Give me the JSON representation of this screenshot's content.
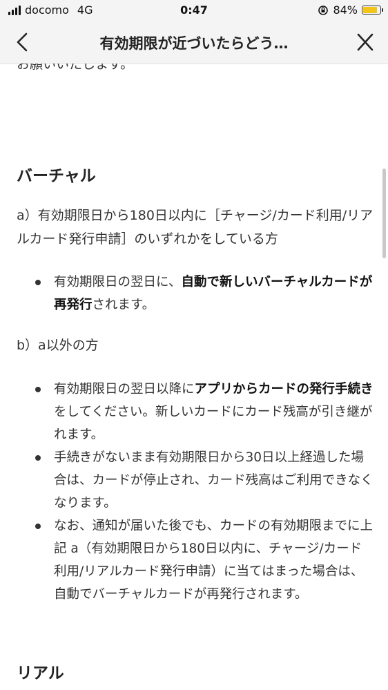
{
  "status_bar": {
    "carrier": "docomo",
    "network": "4G",
    "time": "0:47",
    "battery_percent": "84%",
    "battery_level": 0.84,
    "battery_color": "#f3c519"
  },
  "nav": {
    "title": "有効期限が近づいたらどう…",
    "back_icon": "chevron-left-icon",
    "close_icon": "close-icon"
  },
  "content": {
    "clipped_text": "お願いいたします。",
    "virtual": {
      "heading": "バーチャル",
      "case_a": "a）有効期限日から180日以内に［チャージ/カード利用/リアルカード発行申請］のいずれかをしている方",
      "case_a_bullet": {
        "t1": "有効期限日の翌日に、",
        "b1": "自動で新しいバーチャルカードが再発行",
        "t2": "されます。"
      },
      "case_b": "b）a以外の方",
      "case_b_bullets": [
        {
          "t1": "有効期限日の翌日以降に",
          "b1": "アプリからカードの発行手続き",
          "t2": "をしてください。新しいカードにカード残高が引き継がれます。"
        },
        {
          "t1": "手続きがないまま有効期限日から30日以上経過した場合は、カードが停止され、カード残高はご利用できなくなります。"
        },
        {
          "t1": "なお、通知が届いた後でも、カードの有効期限までに上記 a（有効期限日から180日以内に、チャージ/カード利用/リアルカード発行申請）に当てはまった場合は、自動でバーチャルカードが再発行されます。"
        }
      ]
    },
    "real": {
      "heading": "リアル"
    }
  }
}
